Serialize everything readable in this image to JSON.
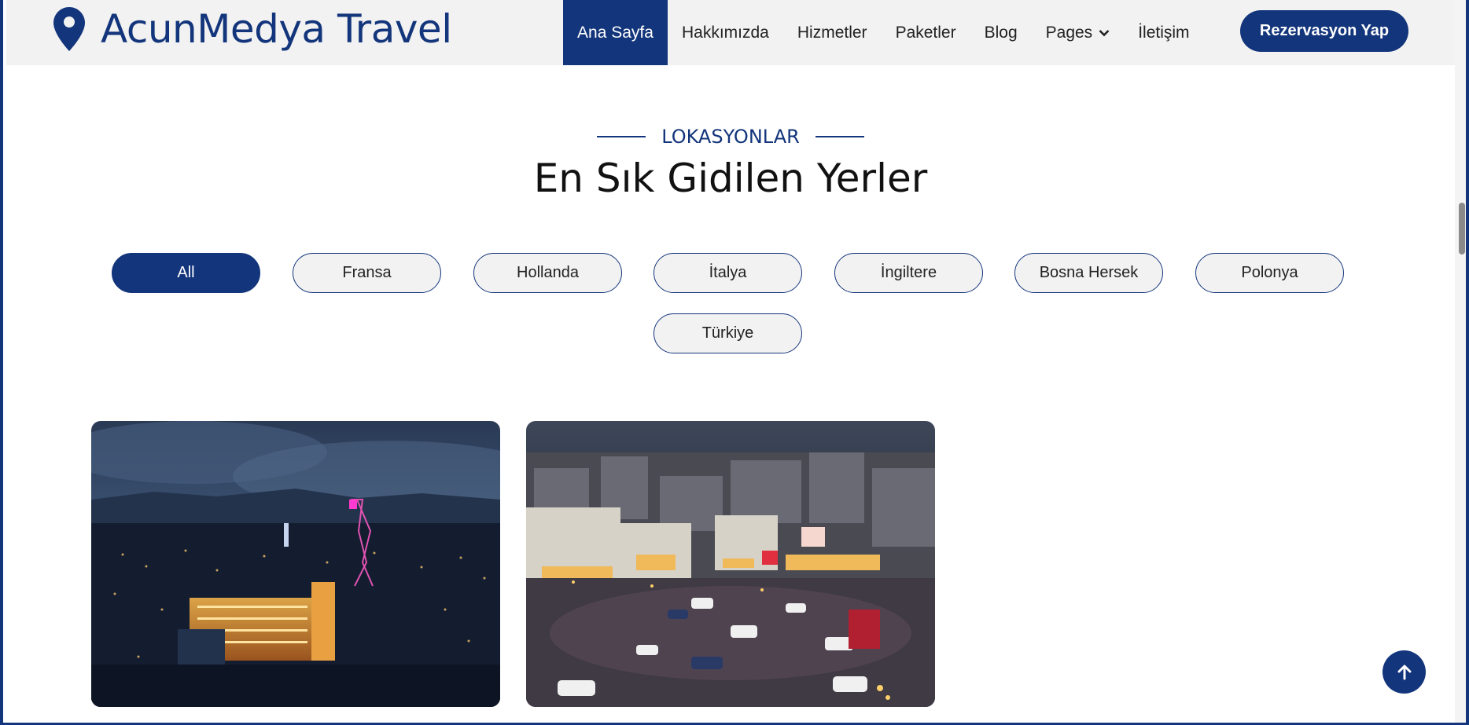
{
  "brand": {
    "name": "AcunMedya Travel",
    "icon": "map-pin-icon"
  },
  "nav": {
    "items": [
      {
        "label": "Ana Sayfa",
        "active": true
      },
      {
        "label": "Hakkımızda"
      },
      {
        "label": "Hizmetler"
      },
      {
        "label": "Paketler"
      },
      {
        "label": "Blog"
      },
      {
        "label": "Pages",
        "dropdown": true
      },
      {
        "label": "İletişim"
      }
    ],
    "cta": "Rezervasyon Yap"
  },
  "section": {
    "eyebrow": "LOKASYONLAR",
    "title": "En Sık Gidilen Yerler"
  },
  "filters": [
    {
      "label": "All",
      "active": true
    },
    {
      "label": "Fransa"
    },
    {
      "label": "Hollanda"
    },
    {
      "label": "İtalya"
    },
    {
      "label": "İngiltere"
    },
    {
      "label": "Bosna Hersek"
    },
    {
      "label": "Polonya"
    },
    {
      "label": "Türkiye"
    }
  ],
  "cards": [
    {
      "image": "night-city-skyline-photo"
    },
    {
      "image": "night-city-square-photo"
    }
  ],
  "colors": {
    "primary": "#13357B",
    "nav_bg": "#f2f2f2",
    "filter_bg": "#f2f2f2"
  },
  "back_to_top_icon": "arrow-up-icon"
}
